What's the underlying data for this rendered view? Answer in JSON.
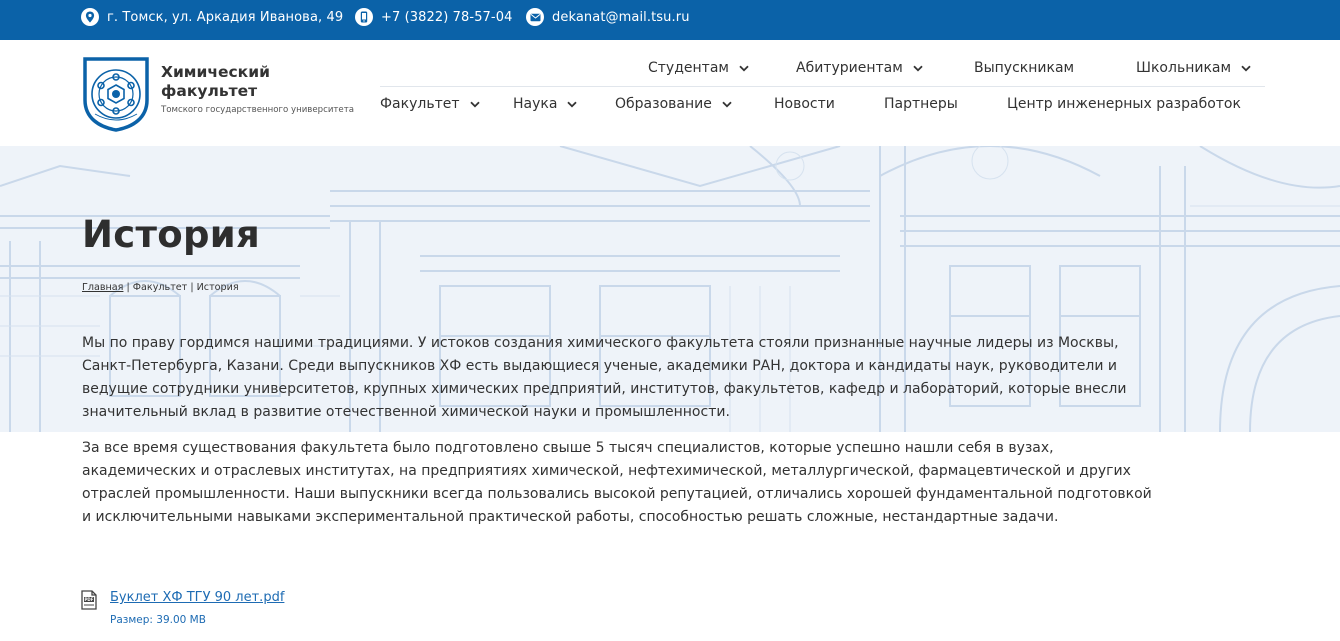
{
  "contacts": {
    "address": "г. Томск, ул. Аркадия Иванова, 49",
    "phone": "+7 (3822) 78-57-04",
    "email": "dekanat@mail.tsu.ru"
  },
  "brand": {
    "title": "Химический факультет",
    "subtitle": "Томского государственного университета"
  },
  "nav_top": [
    {
      "label": "Студентам",
      "dropdown": true
    },
    {
      "label": "Абитуриентам",
      "dropdown": true
    },
    {
      "label": "Выпускникам",
      "dropdown": false
    },
    {
      "label": "Школьникам",
      "dropdown": true
    }
  ],
  "nav_main": [
    {
      "label": "Факультет",
      "dropdown": true
    },
    {
      "label": "Наука",
      "dropdown": true
    },
    {
      "label": "Образование",
      "dropdown": true
    },
    {
      "label": "Новости",
      "dropdown": false
    },
    {
      "label": "Партнеры",
      "dropdown": false
    },
    {
      "label": "Центр инженерных разработок",
      "dropdown": false
    }
  ],
  "page": {
    "title": "История",
    "breadcrumb": {
      "home": "Главная",
      "section": "Факультет",
      "current": "История"
    },
    "paragraphs": [
      "Мы по праву гордимся нашими традициями. У истоков создания химического факультета стояли признанные научные лидеры из Москвы, Санкт-Петербурга, Казани. Среди выпускников ХФ есть выдающиеся ученые, академики РАН, доктора и кандидаты наук, руководители и ведущие сотрудники университетов, крупных химических предприятий, институтов, факультетов, кафедр и лабораторий, которые внесли значительный вклад в развитие отечественной химической науки и промышленности.",
      "За все время существования факультета было подготовлено свыше 5 тысяч специалистов, которые успешно нашли себя в вузах, академических и отраслевых институтах, на предприятиях химической, нефтехимической, металлургической, фармацевтической и других отраслей промышленности. Наши выпускники всегда пользовались высокой репутацией, отличались хорошей фундаментальной подготовкой и исключительными навыками экспериментальной практической работы, способностью решать сложные, нестандартные задачи."
    ],
    "file": {
      "icon_label": "PDF",
      "name": "Буклет ХФ ТГУ 90 лет.pdf",
      "size": "Размер: 39.00 MB"
    }
  },
  "colors": {
    "topbar": "#0b62a8",
    "link": "#1d6bb3",
    "hero_bg": "#eef3f9",
    "hero_lines": "#c9d8ea"
  },
  "icons": [
    "location-icon",
    "phone-icon",
    "mail-icon",
    "chevron-down-icon",
    "pdf-file-icon",
    "faculty-logo"
  ]
}
